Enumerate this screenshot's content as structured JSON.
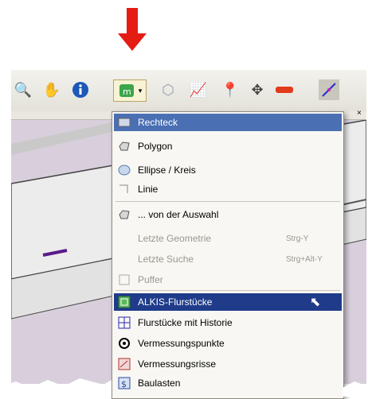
{
  "menu": {
    "items": [
      {
        "label": "Rechteck"
      },
      {
        "label": "Polygon"
      },
      {
        "label": "Ellipse / Kreis"
      },
      {
        "label": "Linie"
      },
      {
        "label": "... von der Auswahl"
      },
      {
        "label": "Letzte Geometrie",
        "shortcut": "Strg-Y"
      },
      {
        "label": "Letzte Suche",
        "shortcut": "Strg+Alt-Y"
      },
      {
        "label": "Puffer"
      },
      {
        "label": "ALKIS-Flurstücke"
      },
      {
        "label": "Flurstücke mit Historie"
      },
      {
        "label": "Vermessungspunkte"
      },
      {
        "label": "Vermessungsrisse"
      },
      {
        "label": "Baulasten"
      }
    ]
  },
  "colors": {
    "arrow": "#e51c14",
    "selected": "#1f3b8a",
    "hover_top": "#4a6fb3"
  },
  "icons": [
    "zoom-icon",
    "hand-icon",
    "info-icon",
    "select-icon",
    "layers-icon",
    "chart-icon",
    "pin-icon",
    "move-icon",
    "minus-icon",
    "line-edit-icon"
  ]
}
